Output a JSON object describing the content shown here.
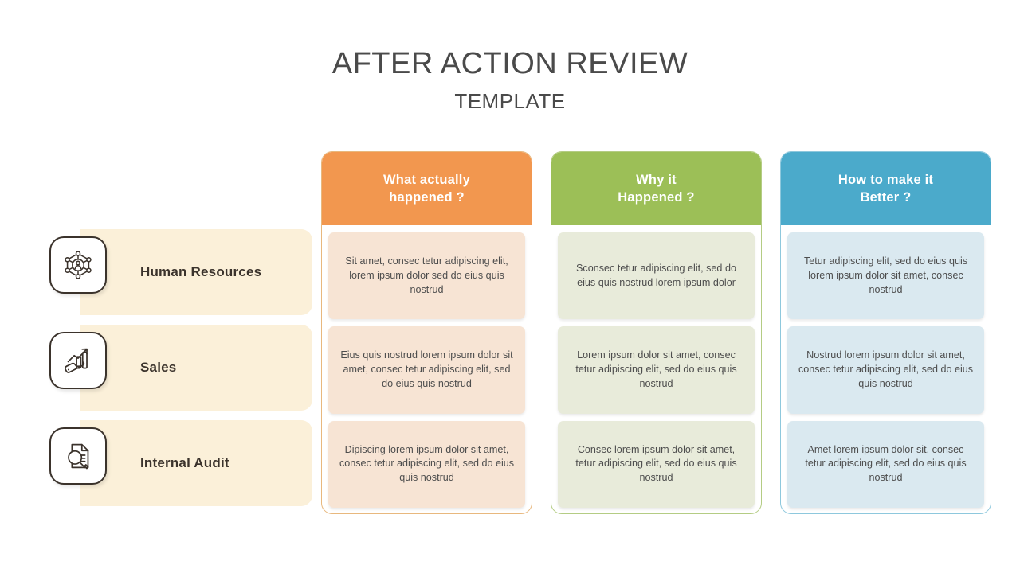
{
  "header": {
    "title": "AFTER ACTION REVIEW",
    "subtitle": "TEMPLATE"
  },
  "colors": {
    "orange": "#F2974F",
    "green": "#9CBF57",
    "blue": "#4BAACB",
    "orange_cell": "#F7E4D4",
    "green_cell": "#E8EBDA",
    "blue_cell": "#DAE9F0",
    "sidebar_band": "#FBF0D9",
    "title_text": "#4a4a4a",
    "body_text": "#4d4d4d"
  },
  "sidebar": {
    "items": [
      {
        "label": "Human Resources",
        "icon": "network-people-icon"
      },
      {
        "label": "Sales",
        "icon": "hand-growth-chart-icon"
      },
      {
        "label": "Internal Audit",
        "icon": "document-magnifier-icon"
      }
    ]
  },
  "columns": [
    {
      "header": "What actually happened ?",
      "header_line1": "What actually",
      "header_line2": "happened ?",
      "accent": "#F2974F",
      "cells": [
        "Sit amet, consec tetur adipiscing elit, lorem ipsum dolor  sed do eius quis nostrud",
        "Eius quis nostrud  lorem ipsum dolor sit amet, consec tetur adipiscing elit, sed do eius quis nostrud",
        "Dipiscing lorem ipsum dolor sit amet, consec tetur adipiscing elit, sed do eius quis nostrud"
      ]
    },
    {
      "header": "Why it Happened ?",
      "header_line1": "Why it",
      "header_line2": "Happened ?",
      "accent": "#9CBF57",
      "cells": [
        "Sconsec tetur adipiscing elit, sed do eius quis nostrud lorem ipsum dolor",
        "Lorem ipsum dolor sit amet, consec tetur adipiscing elit, sed do eius quis nostrud",
        "Consec lorem ipsum dolor sit amet, tetur adipiscing elit, sed do eius quis nostrud"
      ]
    },
    {
      "header": "How to make it Better ?",
      "header_line1": "How to make it",
      "header_line2": "Better ?",
      "accent": "#4BAACB",
      "cells": [
        "Tetur adipiscing elit, sed do eius quis lorem ipsum dolor sit amet, consec nostrud",
        "Nostrud lorem ipsum dolor sit amet, consec tetur adipiscing elit, sed do eius quis nostrud",
        "Amet lorem ipsum dolor sit, consec tetur adipiscing elit, sed do eius quis nostrud"
      ]
    }
  ]
}
